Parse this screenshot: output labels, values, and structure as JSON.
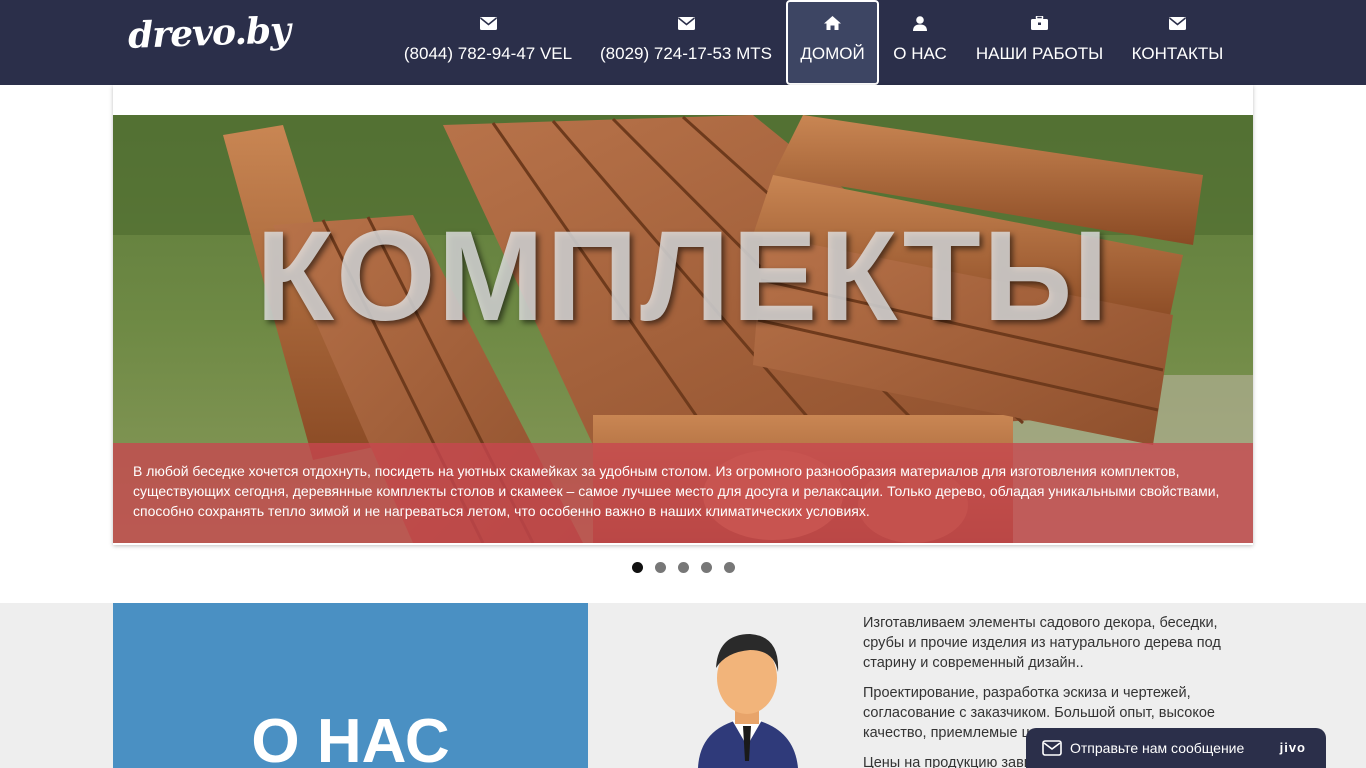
{
  "site": {
    "logo_text": "drevo.by"
  },
  "nav": {
    "items": [
      {
        "icon": "envelope-icon",
        "label": "(8044) 782-94-47 VEL"
      },
      {
        "icon": "envelope-icon",
        "label": "(8029) 724-17-53 MTS"
      },
      {
        "icon": "home-icon",
        "label": "ДОМОЙ",
        "active": true
      },
      {
        "icon": "user-icon",
        "label": "О НАС"
      },
      {
        "icon": "briefcase-icon",
        "label": "НАШИ РАБОТЫ"
      },
      {
        "icon": "envelope-icon",
        "label": "КОНТАКТЫ"
      }
    ]
  },
  "slider": {
    "title": "КОМПЛЕКТЫ",
    "caption": "В любой беседке хочется отдохнуть, посидеть на уютных скамейках за удобным столом. Из огромного разнообразия материалов для изготовления комплектов, существующих сегодня, деревянные комплекты столов и скамеек – самое лучшее место для досуга и релаксации. Только дерево, обладая уникальными свойствами, способно сохранять тепло зимой и не нагреваться летом, что особенно важно в наших климатических условиях.",
    "dot_count": 5,
    "active_dot": 1
  },
  "about": {
    "heading": "О НАС",
    "paragraphs": [
      "Изготавливаем элементы садового декора, беседки, срубы и прочие изделия из натурального дерева под старину и современный дизайн..",
      "Проектирование, разработка эскиза и чертежей, согласование с заказчиком. Большой опыт, высокое качество, приемлемые цены.",
      "Цены на продукцию зависят от"
    ]
  },
  "chat": {
    "label": "Отправьте нам сообщение",
    "brand": "jivo"
  },
  "colors": {
    "navbar": "#2b2f4a",
    "caption_bg": "#c84650",
    "about_blue": "#4a90c3"
  }
}
